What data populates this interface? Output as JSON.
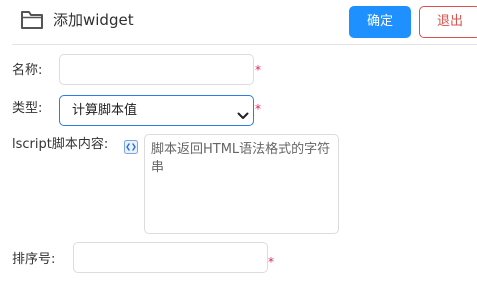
{
  "header": {
    "title": "添加widget",
    "icon": "folder-icon",
    "confirm_label": "确定",
    "exit_label": "退出"
  },
  "form": {
    "name": {
      "label": "名称:",
      "value": "",
      "required_mark": "*"
    },
    "type": {
      "label": "类型:",
      "selected": "计算脚本值",
      "required_mark": "*"
    },
    "script": {
      "label": "lscript脚本内容:",
      "icon": "code-icon",
      "placeholder": "脚本返回HTML语法格式的字符串"
    },
    "order": {
      "label": "排序号:",
      "value": "",
      "required_mark": "*"
    }
  },
  "colors": {
    "primary": "#1e90ff",
    "danger": "#d9534f",
    "required": "#e0245e",
    "select_border": "#2b7de9"
  }
}
